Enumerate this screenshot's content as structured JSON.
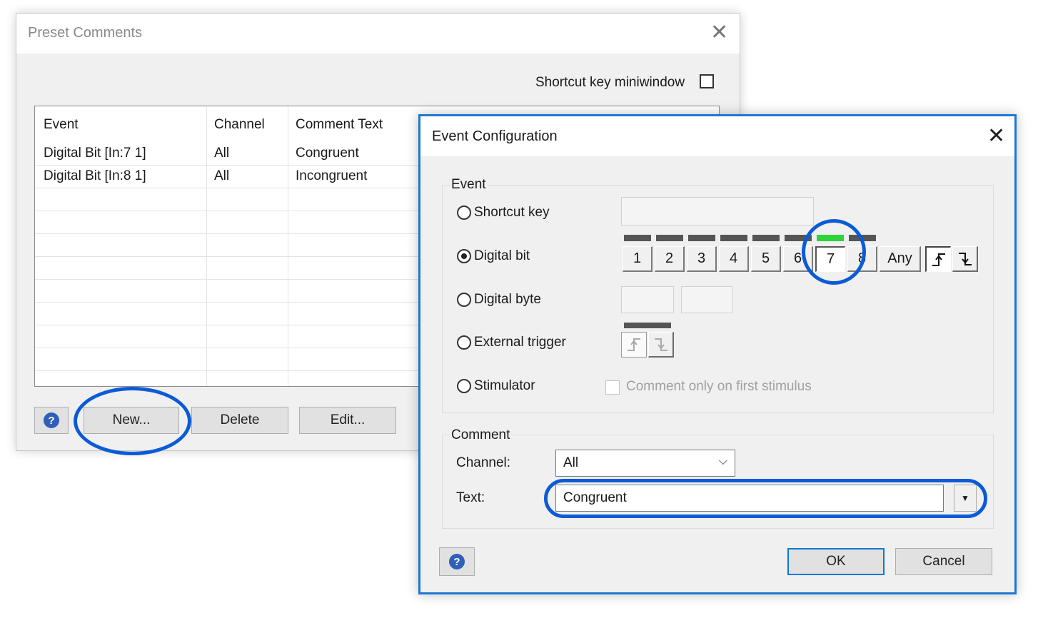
{
  "preset": {
    "title": "Preset Comments",
    "shortcut_label": "Shortcut key miniwindow",
    "columns": [
      "Event",
      "Channel",
      "Comment Text"
    ],
    "rows": [
      {
        "event": "Digital Bit [In:7 1]",
        "channel": "All",
        "text": "Congruent"
      },
      {
        "event": "Digital Bit [In:8 1]",
        "channel": "All",
        "text": "Incongruent"
      }
    ],
    "buttons": {
      "help": "?",
      "new": "New...",
      "delete": "Delete",
      "edit": "Edit..."
    }
  },
  "event_config": {
    "title": "Event Configuration",
    "event_group": "Event",
    "options": {
      "shortcut": "Shortcut key",
      "digital_bit": "Digital bit",
      "digital_byte": "Digital byte",
      "external_trigger": "External trigger",
      "stimulator": "Stimulator"
    },
    "selected_option": "Digital bit",
    "bits": [
      "1",
      "2",
      "3",
      "4",
      "5",
      "6",
      "7",
      "8"
    ],
    "selected_bit": "7",
    "any_label": "Any",
    "stim_checkbox_label": "Comment only on first stimulus",
    "comment_group": "Comment",
    "channel_label": "Channel:",
    "channel_value": "All",
    "text_label": "Text:",
    "text_value": "Congruent",
    "buttons": {
      "help": "?",
      "ok": "OK",
      "cancel": "Cancel"
    }
  },
  "colors": {
    "highlight_circle": "#0b5bd6",
    "led_active": "#2fd33a",
    "led_inactive": "#555555",
    "dialog_border": "#1e78d2"
  }
}
